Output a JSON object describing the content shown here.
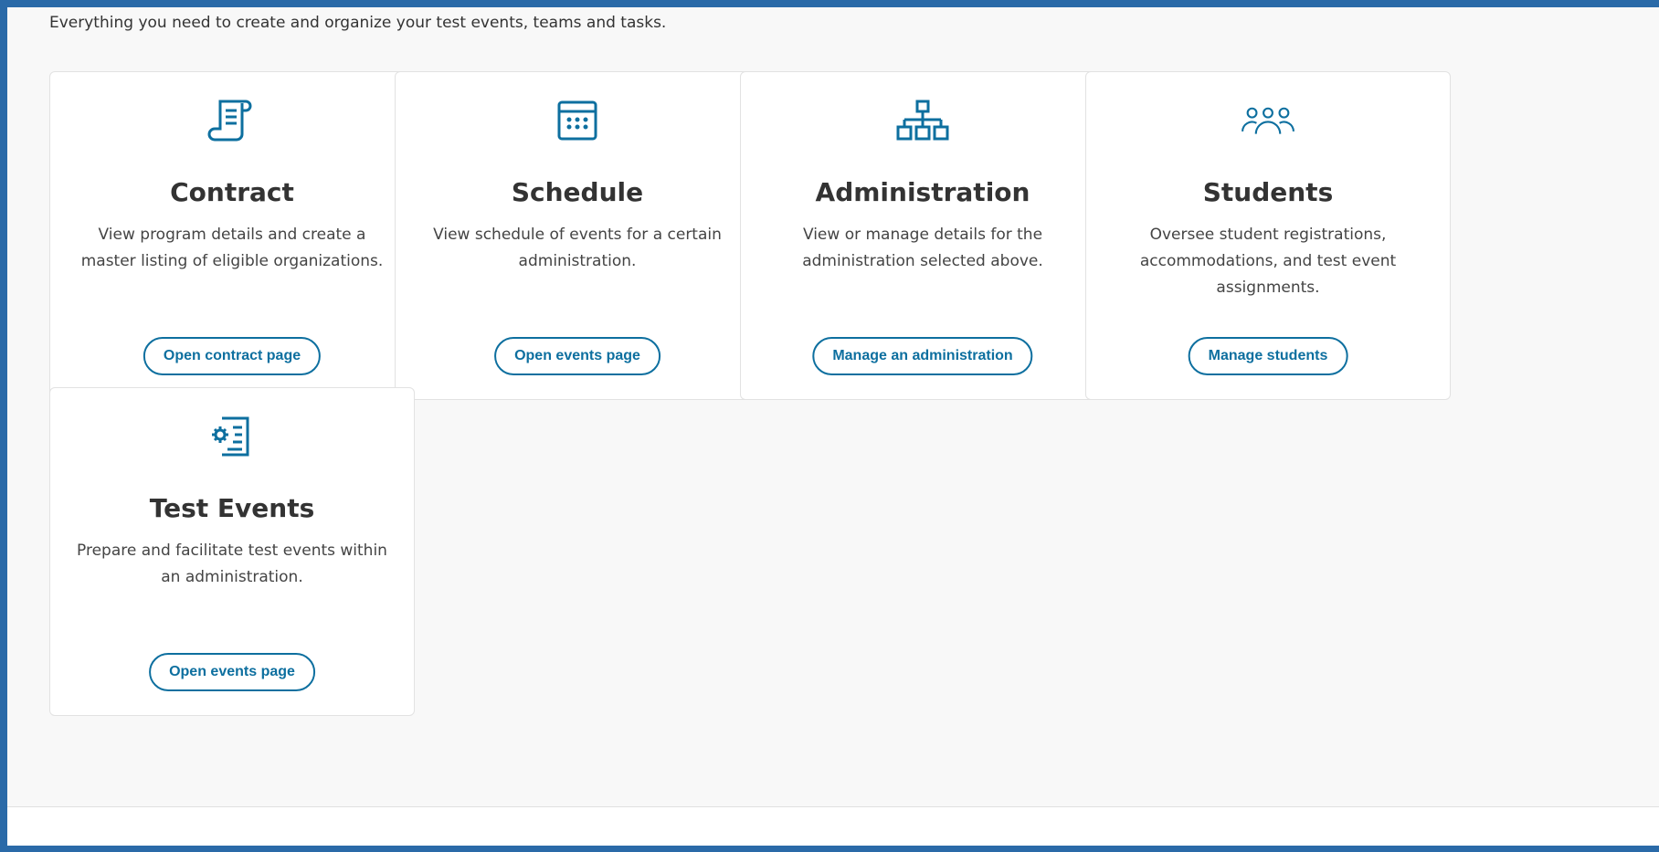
{
  "intro": "Everything you need to create and organize your test events, teams and tasks.",
  "cards": [
    {
      "icon": "scroll-document-icon",
      "title": "Contract",
      "description": "View program details and create a master listing of eligible organizations.",
      "button": "Open contract page"
    },
    {
      "icon": "calendar-grid-icon",
      "title": "Schedule",
      "description": "View schedule of events for a certain administration.",
      "button": "Open events page"
    },
    {
      "icon": "org-chart-icon",
      "title": "Administration",
      "description": "View or manage details for the administration selected above.",
      "button": "Manage an administration"
    },
    {
      "icon": "people-group-icon",
      "title": "Students",
      "description": "Oversee student registrations, accommodations, and test event assignments.",
      "button": "Manage students"
    },
    {
      "icon": "gear-document-icon",
      "title": "Test Events",
      "description": "Prepare and facilitate test events within an administration.",
      "button": "Open events page"
    }
  ],
  "colors": {
    "accent": "#0d6f9f",
    "frame": "#2a6aa8",
    "text": "#333333"
  }
}
